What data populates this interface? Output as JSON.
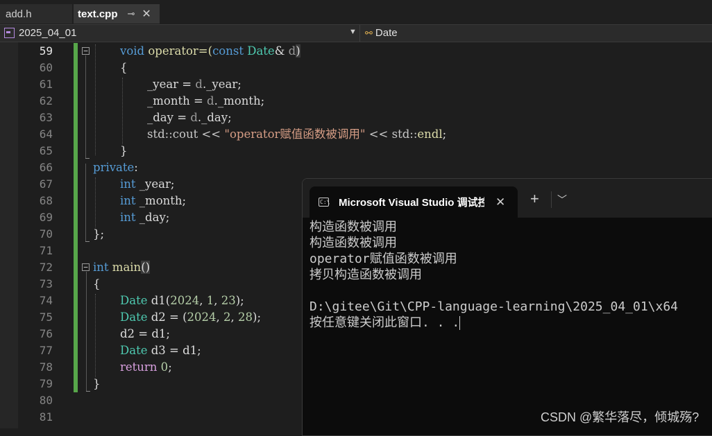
{
  "tabs": [
    {
      "label": "add.h"
    },
    {
      "label": "text.cpp",
      "pin": "⊸",
      "close": "✕"
    }
  ],
  "navbar": {
    "project": "2025_04_01",
    "class": "Date"
  },
  "code": {
    "line_numbers": [
      "59",
      "60",
      "61",
      "62",
      "63",
      "64",
      "65",
      "66",
      "67",
      "68",
      "69",
      "70",
      "71",
      "72",
      "73",
      "74",
      "75",
      "76",
      "77",
      "78",
      "79",
      "80",
      "81"
    ],
    "l59": {
      "kw": "void",
      "fn": "operator=(",
      "kw2": "const",
      "ty": "Date",
      "rest": "& ",
      "prm": "d",
      "close": ")"
    },
    "l60": "{",
    "l61": {
      "m": "_year",
      "eq": " = ",
      "p": "d",
      "dot": ".",
      "m2": "_year",
      "semi": ";"
    },
    "l62": {
      "m": "_month",
      "eq": " = ",
      "p": "d",
      "dot": ".",
      "m2": "_month",
      "semi": ";"
    },
    "l63": {
      "m": "_day",
      "eq": " = ",
      "p": "d",
      "dot": ".",
      "m2": "_day",
      "semi": ";"
    },
    "l64": {
      "pre": "std::cout << ",
      "str": "\"operator赋值函数被调用\"",
      "post": " << std::",
      "fn": "endl",
      "semi": ";"
    },
    "l65": "}",
    "l66": {
      "kw": "private",
      "colon": ":"
    },
    "l67": {
      "kw": "int",
      "m": " _year",
      "semi": ";"
    },
    "l68": {
      "kw": "int",
      "m": " _month",
      "semi": ";"
    },
    "l69": {
      "kw": "int",
      "m": " _day",
      "semi": ";"
    },
    "l70": "};",
    "l72": {
      "kw": "int",
      "fn": " main",
      "paren": "()"
    },
    "l73": "{",
    "l74": {
      "ty": "Date",
      "v": " d1(",
      "n1": "2024",
      "c1": ", ",
      "n2": "1",
      "c2": ", ",
      "n3": "23",
      "end": ");"
    },
    "l75": {
      "ty": "Date",
      "v": " d2 = (",
      "n1": "2024",
      "c1": ", ",
      "n2": "2",
      "c2": ", ",
      "n3": "28",
      "end": ");"
    },
    "l76": "d2 = d1;",
    "l77": {
      "ty": "Date",
      "v": " d3 = d1;"
    },
    "l78": {
      "kw": "return",
      "n": " 0",
      "semi": ";"
    },
    "l79": "}"
  },
  "console": {
    "title": "Microsoft Visual Studio 调试控制台",
    "close": "✕",
    "add": "+",
    "dropdown": "⌄",
    "lines": [
      "构造函数被调用",
      "构造函数被调用",
      "operator赋值函数被调用",
      "拷贝构造函数被调用",
      "",
      "D:\\gitee\\Git\\CPP-language-learning\\2025_04_01\\x64",
      "按任意键关闭此窗口. . ."
    ]
  },
  "watermark": "CSDN @繁华落尽，倾城殇?"
}
